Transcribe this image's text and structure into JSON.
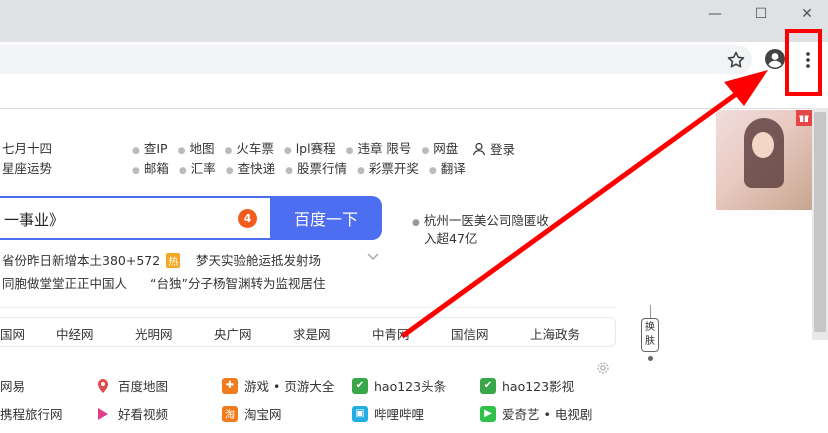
{
  "window": {
    "minimize_glyph": "—",
    "maximize_glyph": "☐",
    "close_glyph": "✕"
  },
  "toolbar": {
    "star_icon": "star-icon",
    "profile_icon": "account-circle-icon",
    "menu_icon": "more-vert-icon"
  },
  "colors": {
    "accent": "#4e6ef2",
    "highlight": "#ff0000",
    "hot_badge": "#f5a623",
    "news_badge": "#f25d1d"
  },
  "left_info": {
    "line1": "七月十四",
    "line2": "星座运势"
  },
  "quick_links": {
    "row1": [
      "查IP",
      "地图",
      "火车票",
      "lpl赛程",
      "违章 限号",
      "网盘"
    ],
    "row2": [
      "邮箱",
      "汇率",
      "查快递",
      "股票行情",
      "彩票开奖",
      "翻译"
    ]
  },
  "login": {
    "label": "登录"
  },
  "search": {
    "value": "一事业》",
    "badge": "4",
    "button_label": "百度一下"
  },
  "hot_news": {
    "item1": "杭州一医美公司隐匿收",
    "item2": "入超47亿"
  },
  "headlines": {
    "row1_left": "省份昨日新增本土380+572",
    "row1_badge": "热",
    "row1_right": "梦天实验舱运抵发射场",
    "row2_left": "同胞做堂堂正正中国人",
    "row2_right": "“台独”分子杨智渊转为监视居住"
  },
  "site_nav": [
    "国网",
    "中经网",
    "光明网",
    "央广网",
    "求是网",
    "中青网",
    "国信网",
    "上海政务"
  ],
  "side_tab": {
    "label1": "换",
    "label2": "肤"
  },
  "ad": {
    "gift_icon": "gift-icon"
  },
  "sites": {
    "row1": [
      "网易",
      "百度地图",
      "游戏 • 页游大全",
      "hao123头条",
      "hao123影视"
    ],
    "row2": [
      "携程旅行网",
      "好看视频",
      "淘宝网",
      "哔哩哔哩",
      "爱奇艺 • 电视剧"
    ]
  }
}
